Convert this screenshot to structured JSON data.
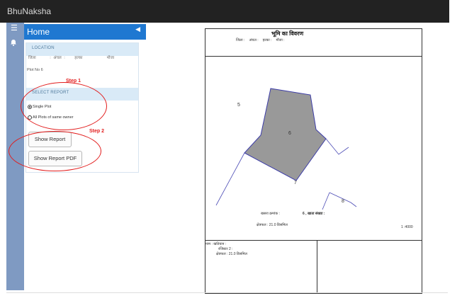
{
  "app": {
    "brand": "BhuNaksha"
  },
  "sidebar": {
    "home": "Home",
    "location_header": "LOCATION",
    "location_fields": [
      "जिला",
      ":",
      "अंचल",
      ":",
      "हल्का",
      "मौजा"
    ],
    "plot_no": "Plot No 6",
    "step1": "Step 1",
    "select_header": "SELECT REPORT",
    "single": "Single Plot",
    "same_owner": "All Plots of same owner",
    "step2": "Step 2",
    "show_report": "Show Report",
    "show_report_pdf": "Show Report PDF"
  },
  "report": {
    "title": "भूमि का विवरण",
    "meta": [
      "जिला :",
      "अंचल :",
      "हल्का :",
      "मौजा :"
    ],
    "plot_labels": [
      "5",
      "6",
      "7",
      "8"
    ],
    "khasra": "खसरा क्रमांक :",
    "plot_value": "6 , खाता संख्या :",
    "area": "क्षेत्रफल : 21.0 डिसमिल",
    "scale": "1 :4000",
    "bottom_left": [
      "नाम : खतियान :",
      "रजिस्टर 2 :",
      "क्षेत्रफल : 21.0 डिसमिल"
    ]
  }
}
